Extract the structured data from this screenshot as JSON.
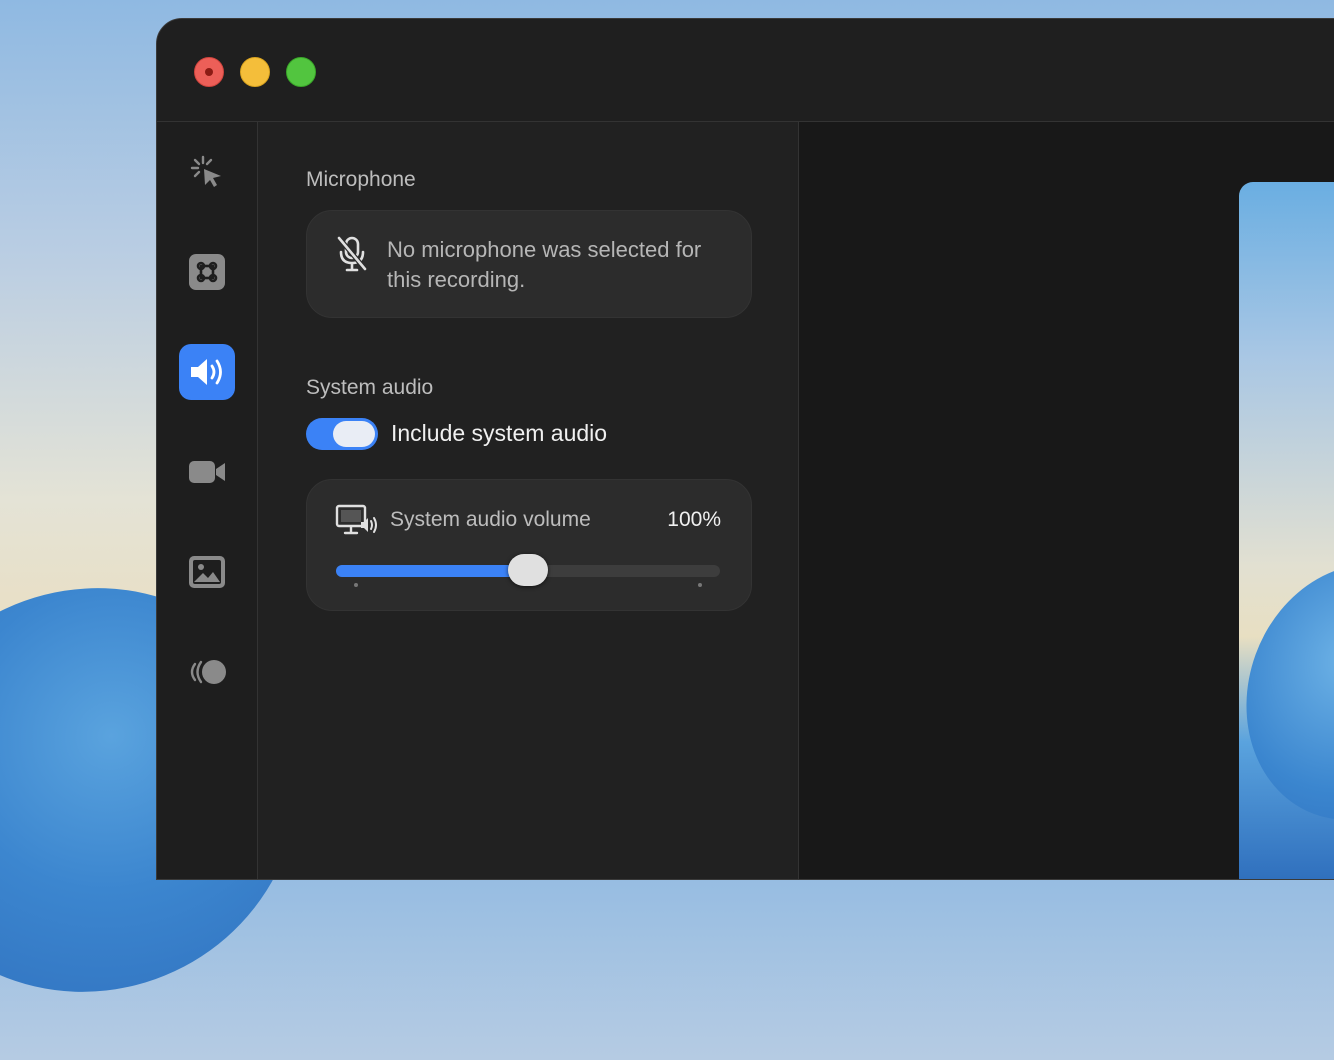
{
  "microphone": {
    "section_title": "Microphone",
    "message": "No microphone was selected for this recording.",
    "icon": "mic-off-icon"
  },
  "system_audio": {
    "section_title": "System audio",
    "toggle_label": "Include system audio",
    "toggle_on": true,
    "volume_label": "System audio volume",
    "volume_value": "100%",
    "slider_fraction": 0.5
  },
  "sidebar": {
    "items": [
      {
        "icon": "cursor-click-icon",
        "active": false
      },
      {
        "icon": "command-key-icon",
        "active": false
      },
      {
        "icon": "speaker-icon",
        "active": true
      },
      {
        "icon": "video-camera-icon",
        "active": false
      },
      {
        "icon": "image-icon",
        "active": false
      },
      {
        "icon": "motion-blur-icon",
        "active": false
      }
    ]
  },
  "colors": {
    "accent": "#3b82f6",
    "window_bg": "#1e1e1e",
    "card_bg": "#2c2c2c"
  }
}
